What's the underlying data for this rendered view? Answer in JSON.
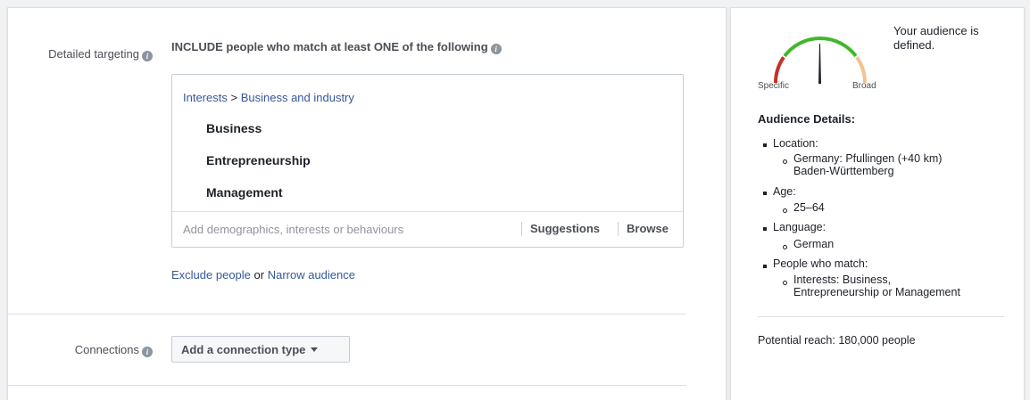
{
  "targeting": {
    "label": "Detailed targeting",
    "include_text": "INCLUDE people who match at least ONE of the following",
    "breadcrumb": {
      "category": "Interests",
      "separator": ">",
      "subcategory": "Business and industry"
    },
    "interests": [
      "Business",
      "Entrepreneurship",
      "Management"
    ],
    "search_placeholder": "Add demographics, interests or behaviours",
    "suggestions_label": "Suggestions",
    "browse_label": "Browse",
    "exclude_label": "Exclude people",
    "or_label": "or",
    "narrow_label": "Narrow audience"
  },
  "connections": {
    "label": "Connections",
    "dropdown_label": "Add a connection type"
  },
  "audience": {
    "meter": {
      "specific_label": "Specific",
      "broad_label": "Broad",
      "colors": {
        "low": "#c5302c",
        "mid": "#42b72a",
        "high": "#f5c28f",
        "needle": "#1d2129"
      }
    },
    "status_line1": "Your audience is",
    "status_line2": "defined.",
    "details_title": "Audience Details:",
    "location_label": "Location:",
    "location_line1": "Germany: Pfullingen (+40 km)",
    "location_line2": "Baden-Württemberg",
    "age_label": "Age:",
    "age_value": "25–64",
    "language_label": "Language:",
    "language_value": "German",
    "match_label": "People who match:",
    "match_line1": "Interests: Business,",
    "match_line2": "Entrepreneurship or Management",
    "reach": "Potential reach: 180,000 people"
  },
  "colors": {
    "link": "#365899",
    "border": "#dddfe2"
  }
}
